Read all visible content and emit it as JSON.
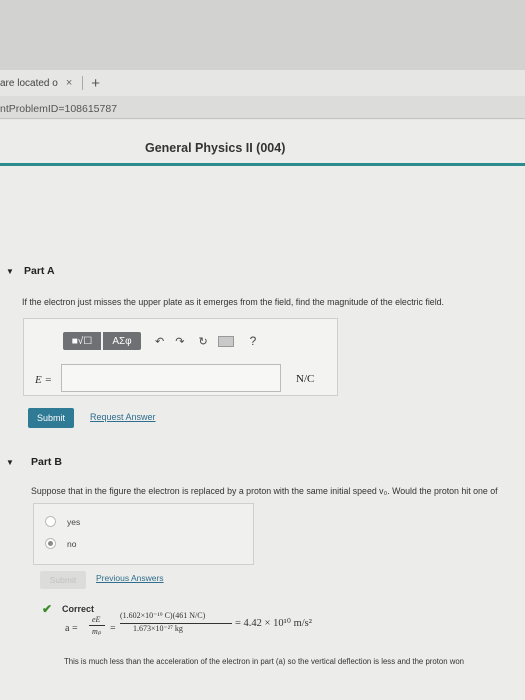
{
  "browser": {
    "tab_label": "are located o",
    "close_glyph": "×",
    "new_tab_glyph": "+",
    "url_fragment": "ntProblemID=108615787"
  },
  "course_title": "General Physics II (004)",
  "part_a": {
    "title": "Part A",
    "question": "If the electron just misses the upper plate as it emerges from the field, find the magnitude of the electric field.",
    "toolbar": {
      "template_label": "■√☐",
      "greek_label": "ΑΣφ",
      "undo_glyph": "↶",
      "redo_glyph": "↷",
      "reset_glyph": "↻",
      "help_glyph": "?"
    },
    "variable_label": "E =",
    "answer_value": "",
    "unit": "N/C",
    "submit_label": "Submit",
    "request_label": "Request Answer"
  },
  "part_b": {
    "title": "Part B",
    "question": "Suppose that in the figure the electron is replaced by a proton with the same initial speed v₀. Would the proton hit one of",
    "options": [
      {
        "label": "yes",
        "selected": false
      },
      {
        "label": "no",
        "selected": true
      }
    ],
    "submit_label": "Submit",
    "previous_label": "Previous Answers",
    "feedback": {
      "title": "Correct",
      "formula_a": "a =",
      "formula_frac_num": "eE",
      "formula_frac_den": "mₚ",
      "formula_eq": "=",
      "formula_num": "(1.602×10⁻¹⁹ C)(461 N/C)",
      "formula_den": "1.673×10⁻²⁷ kg",
      "formula_result": "= 4.42 × 10¹⁰ m/s²",
      "explanation": "This is much less than the acceleration of the electron in part (a) so the vertical deflection is less and the proton won"
    }
  },
  "colors": {
    "accent": "#2c8b8e",
    "button": "#2f7a95",
    "link": "#2f6e8e",
    "correct_check": "#3b8a2a"
  }
}
